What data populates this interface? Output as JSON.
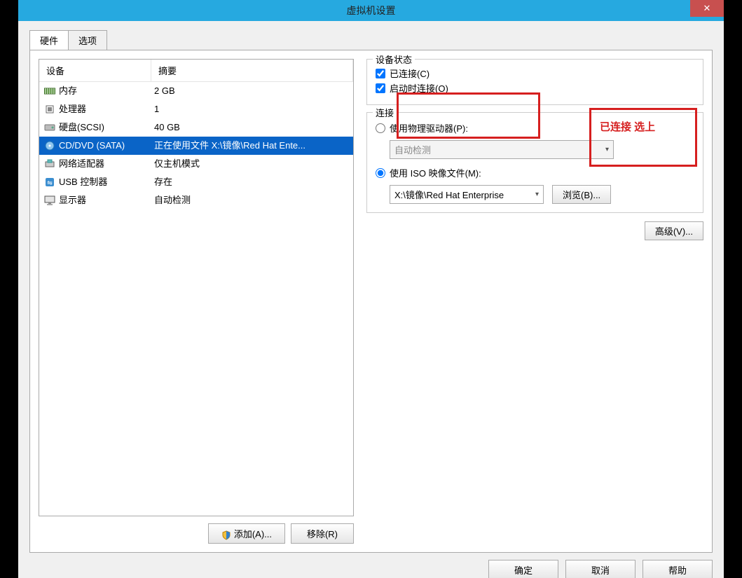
{
  "window": {
    "title": "虚拟机设置"
  },
  "tabs": {
    "hardware": "硬件",
    "options": "选项"
  },
  "listHeader": {
    "device": "设备",
    "summary": "摘要"
  },
  "devices": [
    {
      "name": "内存",
      "summary": "2 GB"
    },
    {
      "name": "处理器",
      "summary": "1"
    },
    {
      "name": "硬盘(SCSI)",
      "summary": "40 GB"
    },
    {
      "name": "CD/DVD (SATA)",
      "summary": "正在使用文件 X:\\镜像\\Red Hat Ente..."
    },
    {
      "name": "网络适配器",
      "summary": "仅主机模式"
    },
    {
      "name": "USB 控制器",
      "summary": "存在"
    },
    {
      "name": "显示器",
      "summary": "自动检测"
    }
  ],
  "buttons": {
    "add": "添加(A)...",
    "remove": "移除(R)",
    "browse": "浏览(B)...",
    "advanced": "高级(V)...",
    "ok": "确定",
    "cancel": "取消",
    "help": "帮助"
  },
  "status": {
    "legend": "设备状态",
    "connected": "已连接(C)",
    "connectOnStart": "启动时连接(O)"
  },
  "connection": {
    "legend": "连接",
    "usePhysical": "使用物理驱动器(P):",
    "physicalValue": "自动检测",
    "useIso": "使用 ISO 映像文件(M):",
    "isoValue": "X:\\镜像\\Red Hat Enterprise"
  },
  "annotation": {
    "text": "已连接 选上"
  }
}
